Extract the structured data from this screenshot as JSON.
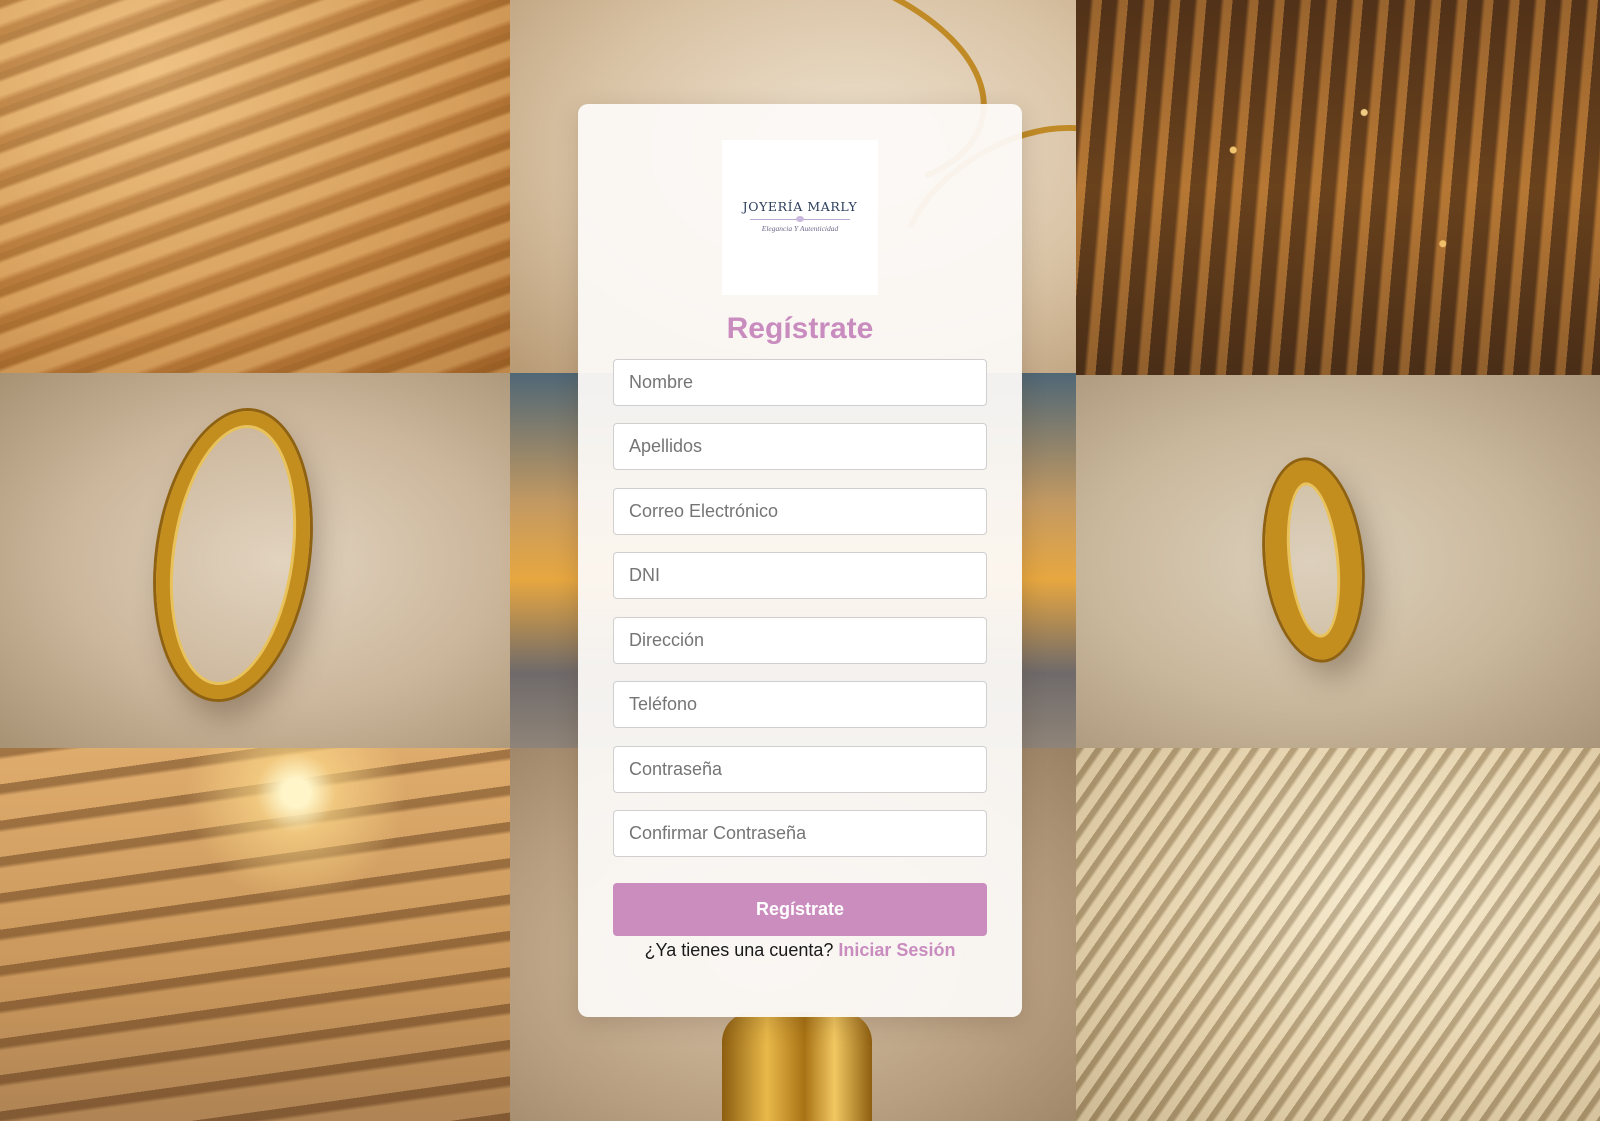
{
  "brand": {
    "name": "JOYERÍA MARLY",
    "tagline": "Elegancia Y Autenticidad"
  },
  "form": {
    "title": "Regístrate",
    "fields": [
      {
        "placeholder": "Nombre"
      },
      {
        "placeholder": "Apellidos"
      },
      {
        "placeholder": "Correo Electrónico"
      },
      {
        "placeholder": "DNI"
      },
      {
        "placeholder": "Dirección"
      },
      {
        "placeholder": "Teléfono"
      },
      {
        "placeholder": "Contraseña"
      },
      {
        "placeholder": "Confirmar Contraseña"
      }
    ],
    "submit_label": "Regístrate",
    "login_prompt": "¿Ya tienes una cuenta?",
    "login_link": "Iniciar Sesión"
  },
  "colors": {
    "accent": "#cb8cbe",
    "card_background": "#fcfaf8"
  },
  "background": {
    "tiles": [
      "sand-dunes",
      "gold-chain-on-silk",
      "glittering-water",
      "gold-ring-on-wood",
      "sunset-sky",
      "gold-ring-on-linen",
      "sunlight-through-blinds",
      "gold-on-sand",
      "palm-shadow-on-water"
    ]
  }
}
